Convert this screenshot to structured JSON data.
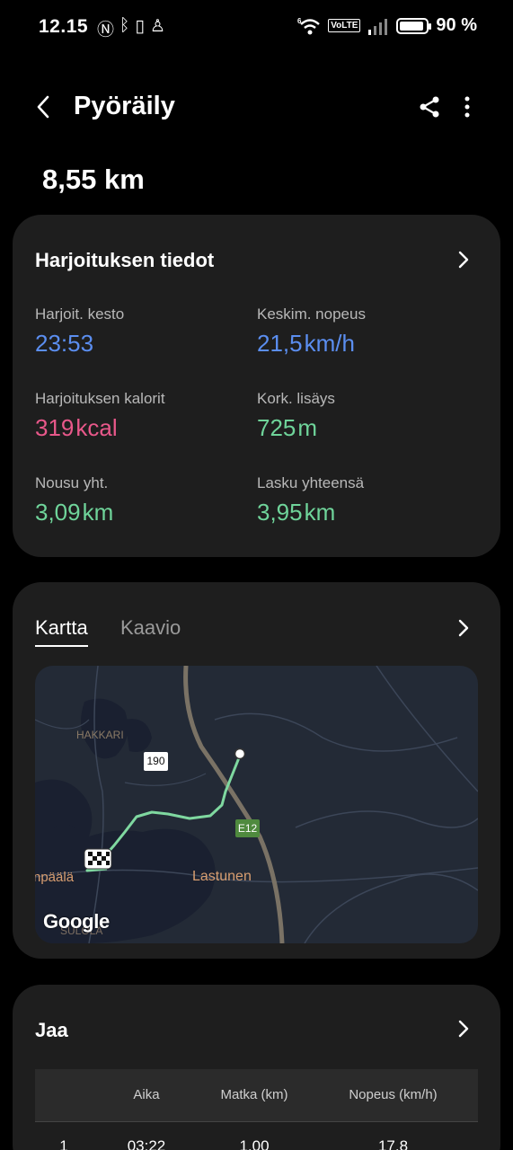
{
  "status_bar": {
    "time": "12.15",
    "battery": "90 %",
    "volte": "VoLTE",
    "wifi_sup": "6"
  },
  "header": {
    "title": "Pyöräily"
  },
  "summary": {
    "distance": "8,55 km"
  },
  "workout": {
    "title": "Harjoituksen tiedot",
    "stats": [
      {
        "label": "Harjoit. kesto",
        "value": "23:53",
        "unit": "",
        "color": "#5b8ef0"
      },
      {
        "label": "Keskim. nopeus",
        "value": "21,5",
        "unit": "km/h",
        "color": "#5b8ef0"
      },
      {
        "label": "Harjoituksen kalorit",
        "value": "319",
        "unit": "kcal",
        "color": "#e8588a"
      },
      {
        "label": "Kork. lisäys",
        "value": "725",
        "unit": "m",
        "color": "#6fd49a"
      },
      {
        "label": "Nousu yht.",
        "value": "3,09",
        "unit": "km",
        "color": "#6fd49a"
      },
      {
        "label": "Lasku yhteensä",
        "value": "3,95",
        "unit": "km",
        "color": "#6fd49a"
      }
    ]
  },
  "map_card": {
    "tabs": [
      "Kartta",
      "Kaavio"
    ],
    "active_tab": "Kartta",
    "labels": {
      "hakkari": "HAKKARI",
      "lastunen": "Lastunen",
      "paala": "npäälä",
      "sulo": "SULOLA",
      "road_190": "190",
      "road_e12": "E12",
      "google": "Google"
    },
    "route_color": "#7fd8a0"
  },
  "splits": {
    "title": "Jaa",
    "headers": [
      "",
      "Aika",
      "Matka (km)",
      "Nopeus (km/h)"
    ],
    "rows": [
      [
        "1",
        "03:22",
        "1,00",
        "17,8"
      ]
    ]
  }
}
